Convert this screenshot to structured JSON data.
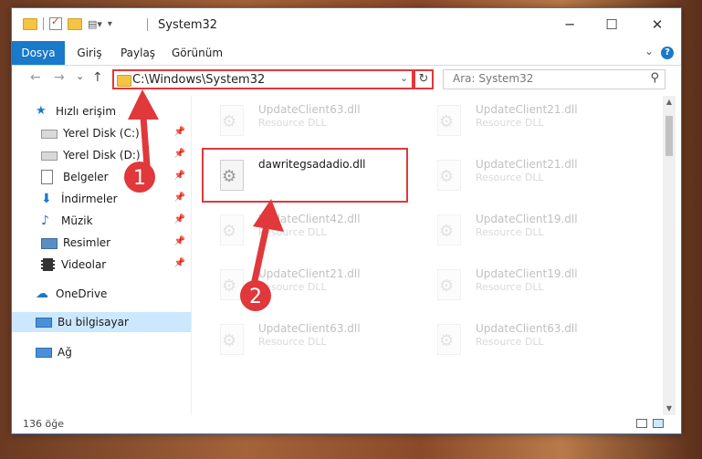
{
  "window": {
    "title": "System32"
  },
  "window_controls": {
    "minimize": "─",
    "maximize": "☐",
    "close": "✕"
  },
  "ribbon": {
    "tabs": [
      {
        "label": "Dosya",
        "active": true
      },
      {
        "label": "Giriş"
      },
      {
        "label": "Paylaş"
      },
      {
        "label": "Görünüm"
      }
    ],
    "help": "?"
  },
  "nav": {
    "back": "←",
    "forward": "→",
    "recent": "⌄",
    "up": "↑",
    "address": "C:\\Windows\\System32",
    "refresh": "↻",
    "search_placeholder": "Ara: System32"
  },
  "sidebar": {
    "items": [
      {
        "label": "Hızlı erişim",
        "icon": "star-icon"
      },
      {
        "label": "Yerel Disk (C:)",
        "icon": "drive-icon",
        "pinned": true
      },
      {
        "label": "Yerel Disk (D:)",
        "icon": "drive-icon",
        "pinned": true
      },
      {
        "label": "Belgeler",
        "icon": "documents-icon",
        "pinned": true
      },
      {
        "label": "İndirmeler",
        "icon": "downloads-icon",
        "pinned": true
      },
      {
        "label": "Müzik",
        "icon": "music-icon",
        "pinned": true
      },
      {
        "label": "Resimler",
        "icon": "pictures-icon",
        "pinned": true
      },
      {
        "label": "Videolar",
        "icon": "videos-icon",
        "pinned": true
      },
      {
        "label": "OneDrive",
        "icon": "cloud-icon"
      },
      {
        "label": "Bu bilgisayar",
        "icon": "computer-icon",
        "selected": true
      },
      {
        "label": "Ağ",
        "icon": "network-icon"
      }
    ]
  },
  "files": [
    {
      "name": "UpdateClient63.dll",
      "desc": "Resource DLL",
      "faded": true
    },
    {
      "name": "UpdateClient21.dll",
      "desc": "Resource DLL",
      "faded": true
    },
    {
      "name": "dawritegsadadio.dll",
      "desc": "",
      "faded": false
    },
    {
      "name": "UpdateClient21.dll",
      "desc": "Resource DLL",
      "faded": true
    },
    {
      "name": "UpdateClient42.dll",
      "desc": "Resource DLL",
      "faded": true
    },
    {
      "name": "UpdateClient19.dll",
      "desc": "Resource DLL",
      "faded": true
    },
    {
      "name": "UpdateClient21.dll",
      "desc": "Resource DLL",
      "faded": true
    },
    {
      "name": "UpdateClient19.dll",
      "desc": "Resource DLL",
      "faded": true
    },
    {
      "name": "UpdateClient63.dll",
      "desc": "Resource DLL",
      "faded": true
    },
    {
      "name": "UpdateClient63.dll",
      "desc": "Resource DLL",
      "faded": true
    }
  ],
  "status": {
    "count": "136 öğe"
  },
  "annotations": {
    "step1": "1",
    "step2": "2",
    "color": "#e0383b"
  }
}
